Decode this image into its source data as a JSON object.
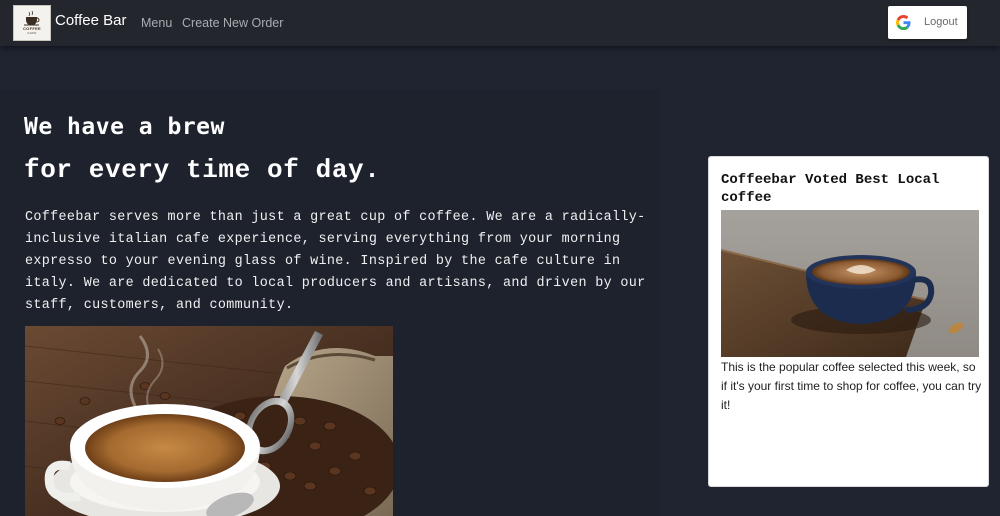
{
  "navbar": {
    "brand": "Coffee Bar",
    "logo": {
      "title": "COFFEE",
      "subtitle": "CAFE",
      "icon": "coffee-cup-logo-icon"
    },
    "links": [
      "Menu",
      "Create New Order"
    ],
    "logout": {
      "label": "Logout",
      "icon": "google-icon"
    }
  },
  "hero": {
    "headline_line1": "We have a brew",
    "headline_line2": "for every time of day.",
    "intro": "Coffeebar serves more than just a great cup of coffee. We are a radically-inclusive italian cafe experience, serving everything from your morning expresso to your evening glass of wine. Inspired by the cafe culture in italy. We are dedicated to local producers and artisans, and driven by our staff, customers, and community.",
    "image": "coffee-cup-with-beans-and-scoop-photo"
  },
  "card": {
    "title": "Coffeebar Voted Best Local coffee",
    "image": "latte-cup-on-wooden-board-photo",
    "text": "This is the popular coffee selected this week, so if it's your first time to shop for coffee, you can try it!"
  },
  "colors": {
    "background": "#1f2430",
    "navbar": "#23262c",
    "card": "#ffffff",
    "nav_link": "#a9acb2"
  }
}
